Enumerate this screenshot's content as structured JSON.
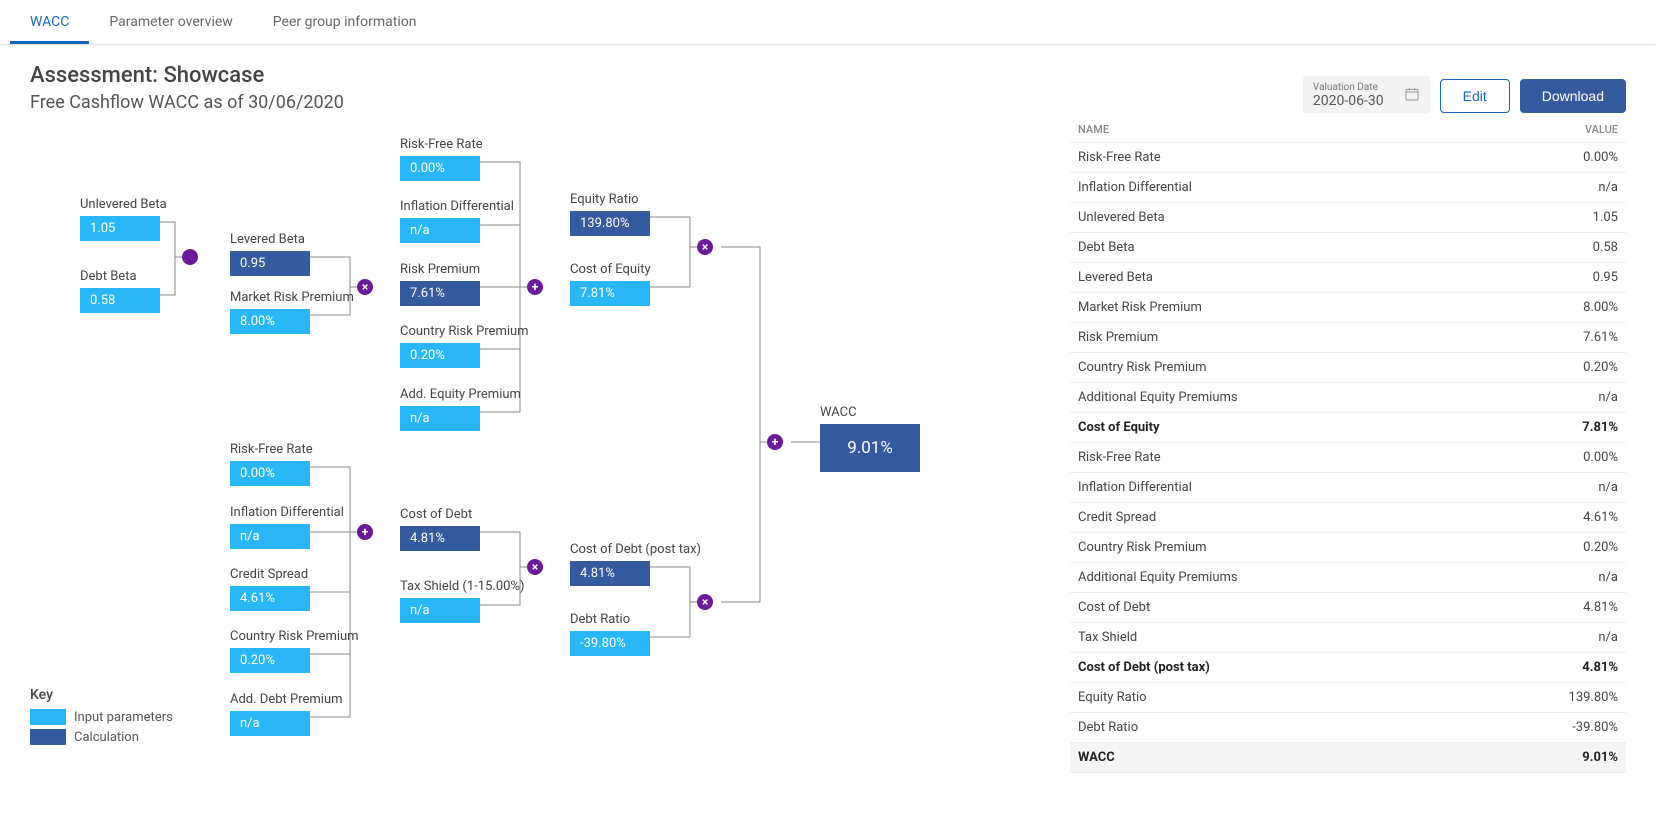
{
  "tabs": {
    "wacc": "WACC",
    "params": "Parameter overview",
    "peer": "Peer group information"
  },
  "header": {
    "title": "Assessment: Showcase",
    "subtitle": "Free Cashflow WACC as of 30/06/2020",
    "date_label": "Valuation Date",
    "date_value": "2020-06-30",
    "edit": "Edit",
    "download": "Download"
  },
  "key": {
    "title": "Key",
    "input": "Input parameters",
    "calc": "Calculation"
  },
  "colors": {
    "input": "#29b6f6",
    "calc": "#355a9e",
    "op": "#6a1b9a"
  },
  "nodes": {
    "unlevered_beta": {
      "label": "Unlevered Beta",
      "value": "1.05"
    },
    "debt_beta": {
      "label": "Debt Beta",
      "value": "0.58"
    },
    "levered_beta": {
      "label": "Levered Beta",
      "value": "0.95"
    },
    "market_risk": {
      "label": "Market Risk Premium",
      "value": "8.00%"
    },
    "risk_free1": {
      "label": "Risk-Free Rate",
      "value": "0.00%"
    },
    "infl_diff1": {
      "label": "Inflation Differential",
      "value": "n/a"
    },
    "risk_premium": {
      "label": "Risk Premium",
      "value": "7.61%"
    },
    "country_risk1": {
      "label": "Country Risk Premium",
      "value": "0.20%"
    },
    "add_equity": {
      "label": "Add. Equity Premium",
      "value": "n/a"
    },
    "equity_ratio": {
      "label": "Equity Ratio",
      "value": "139.80%"
    },
    "cost_equity": {
      "label": "Cost of Equity",
      "value": "7.81%"
    },
    "risk_free2": {
      "label": "Risk-Free Rate",
      "value": "0.00%"
    },
    "infl_diff2": {
      "label": "Inflation Differential",
      "value": "n/a"
    },
    "credit_spread": {
      "label": "Credit Spread",
      "value": "4.61%"
    },
    "country_risk2": {
      "label": "Country Risk Premium",
      "value": "0.20%"
    },
    "add_debt": {
      "label": "Add. Debt Premium",
      "value": "n/a"
    },
    "cost_debt": {
      "label": "Cost of Debt",
      "value": "4.81%"
    },
    "tax_shield": {
      "label": "Tax Shield (1-15.00%)",
      "value": "n/a"
    },
    "cost_debt_post": {
      "label": "Cost of Debt (post tax)",
      "value": "4.81%"
    },
    "debt_ratio": {
      "label": "Debt Ratio",
      "value": "-39.80%"
    },
    "wacc": {
      "label": "WACC",
      "value": "9.01%"
    }
  },
  "table": {
    "name_header": "Name",
    "value_header": "Value",
    "rows": [
      {
        "n": "Risk-Free Rate",
        "v": "0.00%"
      },
      {
        "n": "Inflation Differential",
        "v": "n/a"
      },
      {
        "n": "Unlevered Beta",
        "v": "1.05"
      },
      {
        "n": "Debt Beta",
        "v": "0.58"
      },
      {
        "n": "Levered Beta",
        "v": "0.95"
      },
      {
        "n": "Market Risk Premium",
        "v": "8.00%"
      },
      {
        "n": "Risk Premium",
        "v": "7.61%"
      },
      {
        "n": "Country Risk Premium",
        "v": "0.20%"
      },
      {
        "n": "Additional Equity Premiums",
        "v": "n/a"
      },
      {
        "n": "Cost of Equity",
        "v": "7.81%",
        "bold": true
      },
      {
        "n": "Risk-Free Rate",
        "v": "0.00%"
      },
      {
        "n": "Inflation Differential",
        "v": "n/a"
      },
      {
        "n": "Credit Spread",
        "v": "4.61%"
      },
      {
        "n": "Country Risk Premium",
        "v": "0.20%"
      },
      {
        "n": "Additional Equity Premiums",
        "v": "n/a"
      },
      {
        "n": "Cost of Debt",
        "v": "4.81%"
      },
      {
        "n": "Tax Shield",
        "v": "n/a"
      },
      {
        "n": "Cost of Debt (post tax)",
        "v": "4.81%",
        "bold": true
      },
      {
        "n": "Equity Ratio",
        "v": "139.80%"
      },
      {
        "n": "Debt Ratio",
        "v": "-39.80%"
      },
      {
        "n": "WACC",
        "v": "9.01%",
        "bold": true,
        "gray": true
      }
    ]
  },
  "chart_data": {
    "type": "tree",
    "note": "WACC computation tree. 'op' is the combining operator. input=user-provided, calc=derived.",
    "root": {
      "name": "WACC",
      "value": "9.01%",
      "kind": "calc",
      "op": "+",
      "children": [
        {
          "name": "Cost of Equity × Equity Ratio",
          "op": "×",
          "children": [
            {
              "name": "Equity Ratio",
              "value": "139.80%",
              "kind": "calc"
            },
            {
              "name": "Cost of Equity",
              "value": "7.81%",
              "kind": "input",
              "op": "+",
              "children": [
                {
                  "name": "Risk-Free Rate",
                  "value": "0.00%",
                  "kind": "input"
                },
                {
                  "name": "Inflation Differential",
                  "value": "n/a",
                  "kind": "input"
                },
                {
                  "name": "Risk Premium",
                  "value": "7.61%",
                  "kind": "calc",
                  "op": "×",
                  "children": [
                    {
                      "name": "Levered Beta",
                      "value": "0.95",
                      "kind": "calc",
                      "op": "·",
                      "children": [
                        {
                          "name": "Unlevered Beta",
                          "value": "1.05",
                          "kind": "input"
                        },
                        {
                          "name": "Debt Beta",
                          "value": "0.58",
                          "kind": "input"
                        }
                      ]
                    },
                    {
                      "name": "Market Risk Premium",
                      "value": "8.00%",
                      "kind": "input"
                    }
                  ]
                },
                {
                  "name": "Country Risk Premium",
                  "value": "0.20%",
                  "kind": "input"
                },
                {
                  "name": "Add. Equity Premium",
                  "value": "n/a",
                  "kind": "input"
                }
              ]
            }
          ]
        },
        {
          "name": "Cost of Debt (post tax) × Debt Ratio",
          "op": "×",
          "children": [
            {
              "name": "Cost of Debt (post tax)",
              "value": "4.81%",
              "kind": "calc",
              "op": "×",
              "children": [
                {
                  "name": "Cost of Debt",
                  "value": "4.81%",
                  "kind": "calc",
                  "op": "+",
                  "children": [
                    {
                      "name": "Risk-Free Rate",
                      "value": "0.00%",
                      "kind": "input"
                    },
                    {
                      "name": "Inflation Differential",
                      "value": "n/a",
                      "kind": "input"
                    },
                    {
                      "name": "Credit Spread",
                      "value": "4.61%",
                      "kind": "input"
                    },
                    {
                      "name": "Country Risk Premium",
                      "value": "0.20%",
                      "kind": "input"
                    },
                    {
                      "name": "Add. Debt Premium",
                      "value": "n/a",
                      "kind": "input"
                    }
                  ]
                },
                {
                  "name": "Tax Shield (1-15.00%)",
                  "value": "n/a",
                  "kind": "input"
                }
              ]
            },
            {
              "name": "Debt Ratio",
              "value": "-39.80%",
              "kind": "input"
            }
          ]
        }
      ]
    }
  }
}
